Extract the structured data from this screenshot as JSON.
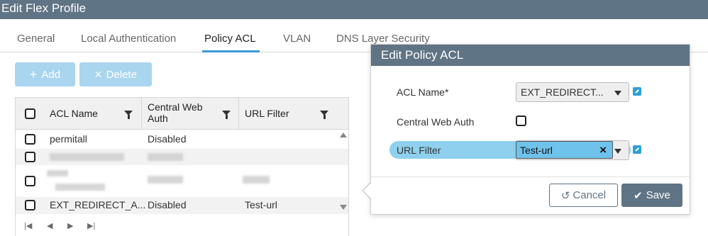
{
  "window": {
    "title": "Edit Flex Profile"
  },
  "tabs": [
    {
      "label": "General"
    },
    {
      "label": "Local Authentication"
    },
    {
      "label": "Policy ACL"
    },
    {
      "label": "VLAN"
    },
    {
      "label": "DNS Layer Security"
    }
  ],
  "active_tab": "Policy ACL",
  "toolbar": {
    "add_label": "Add",
    "delete_label": "Delete",
    "add_icon": "plus-icon",
    "delete_icon": "close-icon"
  },
  "grid": {
    "columns": [
      "ACL Name",
      "Central Web\nAuth",
      "URL Filter"
    ],
    "rows": [
      {
        "acl_name": "permitall",
        "central_web_auth": "Disabled",
        "url_filter": ""
      },
      {
        "acl_name": "EXT_REDIRECT_A...",
        "central_web_auth": "Disabled",
        "url_filter": "Test-url"
      }
    ],
    "pager_icons": [
      "first-page-icon",
      "prev-page-icon",
      "next-page-icon",
      "last-page-icon"
    ]
  },
  "popover": {
    "title": "Edit Policy ACL",
    "acl_name_label": "ACL Name*",
    "acl_name_value": "EXT_REDIRECT...",
    "cwa_label": "Central Web Auth",
    "cwa_checked": false,
    "url_filter_label": "URL Filter",
    "url_filter_value": "Test-url",
    "cancel_label": "Cancel",
    "save_label": "Save",
    "cancel_icon": "undo-icon",
    "save_icon": "checkmark-icon"
  },
  "colors": {
    "header": "#5f7485",
    "accent": "#3b9bd0",
    "highlight": "#8ed0ee",
    "link_icon": "#2f9fd8"
  }
}
